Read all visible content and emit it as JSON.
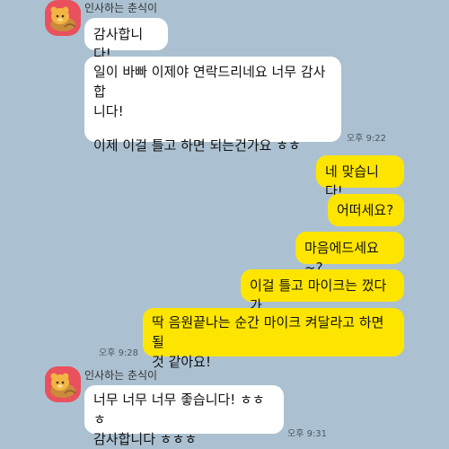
{
  "chat": {
    "partner_name": "인사하는 춘식이",
    "messages": [
      {
        "id": "m1",
        "from": "partner",
        "lines": [
          "감사합니다!"
        ]
      },
      {
        "id": "m2",
        "from": "partner",
        "lines": [
          "일이 바빠 이제야 연락드리네요 너무 감사합",
          "니다!",
          "",
          "이제 이걸 틀고 하면 되는건가요 ㅎㅎ"
        ],
        "time": "오후 9:22"
      },
      {
        "id": "m3",
        "from": "me",
        "lines": [
          "네 맞습니다!"
        ]
      },
      {
        "id": "m4",
        "from": "me",
        "lines": [
          "어떠세요?"
        ]
      },
      {
        "id": "m5",
        "from": "me",
        "lines": [
          "마음에드세요~?"
        ]
      },
      {
        "id": "m6",
        "from": "me",
        "lines": [
          "이걸 틀고 마이크는 껐다가"
        ]
      },
      {
        "id": "m7",
        "from": "me",
        "lines": [
          "딱 음원끝나는 순간 마이크 켜달라고 하면 될",
          "것 같아요!"
        ],
        "time": "오후 9:28"
      },
      {
        "id": "m8",
        "from": "partner",
        "lines": [
          "너무 너무 너무 좋습니다! ㅎㅎㅎ",
          "감사합니다 ㅎㅎㅎ"
        ],
        "time": "오후 9:31"
      }
    ]
  },
  "colors": {
    "background": "#abc1d1",
    "my_bubble": "#fee500",
    "partner_bubble": "#ffffff",
    "avatar_bg": "#e9515d"
  },
  "icons": {
    "avatar": "choonsik-avatar-icon"
  }
}
